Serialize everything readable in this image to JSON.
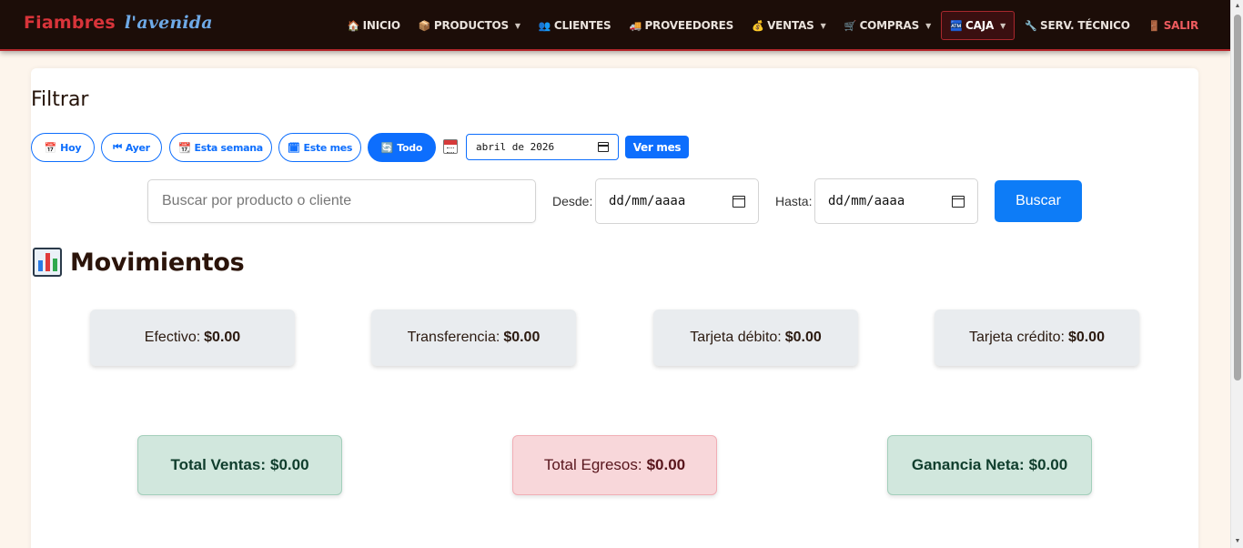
{
  "brand": {
    "part1": "Fiambres",
    "part2": "l'avenida"
  },
  "nav": {
    "items": [
      {
        "label": "INICIO",
        "icon": "🏠"
      },
      {
        "label": "PRODUCTOS",
        "icon": "📦",
        "caret": "▼"
      },
      {
        "label": "CLIENTES",
        "icon": "👥"
      },
      {
        "label": "PROVEEDORES",
        "icon": "🚚"
      },
      {
        "label": "VENTAS",
        "icon": "💰",
        "caret": "▼"
      },
      {
        "label": "COMPRAS",
        "icon": "🛒",
        "caret": "▼"
      },
      {
        "label": "CAJA",
        "icon": "🏧",
        "caret": "▼"
      },
      {
        "label": "SERV. TÉCNICO",
        "icon": "🔧"
      },
      {
        "label": "SALIR",
        "icon": "🚪"
      }
    ]
  },
  "filter": {
    "title": "Filtrar",
    "quick": [
      {
        "label": "Hoy",
        "icon": "📅"
      },
      {
        "label": "Ayer",
        "icon": "⏮"
      },
      {
        "label": "Esta semana",
        "icon": "📆"
      },
      {
        "label": "Este mes",
        "icon": "🗓"
      },
      {
        "label": "Todo",
        "icon": "🔄"
      }
    ],
    "month_value": "abril de 2026",
    "ver_mes_label": "Ver mes"
  },
  "search": {
    "placeholder": "Buscar por producto o cliente",
    "desde_label": "Desde:",
    "desde_value": "dd/mm/aaaa",
    "hasta_label": "Hasta:",
    "hasta_value": "dd/mm/aaaa",
    "button_label": "Buscar"
  },
  "movimientos": {
    "title": "Movimientos",
    "stats": [
      {
        "label": "Efectivo:",
        "value": "$0.00"
      },
      {
        "label": "Transferencia:",
        "value": "$0.00"
      },
      {
        "label": "Tarjeta débito:",
        "value": "$0.00"
      },
      {
        "label": "Tarjeta crédito:",
        "value": "$0.00"
      }
    ],
    "totals": {
      "ventas_label": "Total Ventas:",
      "ventas_value": "$0.00",
      "egresos_label": "Total Egresos:",
      "egresos_value": "$0.00",
      "ganancia_label": "Ganancia Neta:",
      "ganancia_value": "$0.00"
    }
  },
  "colors": {
    "navbar_bg": "#1c0d08",
    "accent_red": "#b3262b",
    "primary_blue": "#0d6efd",
    "success_bg": "#d1e7dd",
    "danger_bg": "#f8d7da"
  }
}
